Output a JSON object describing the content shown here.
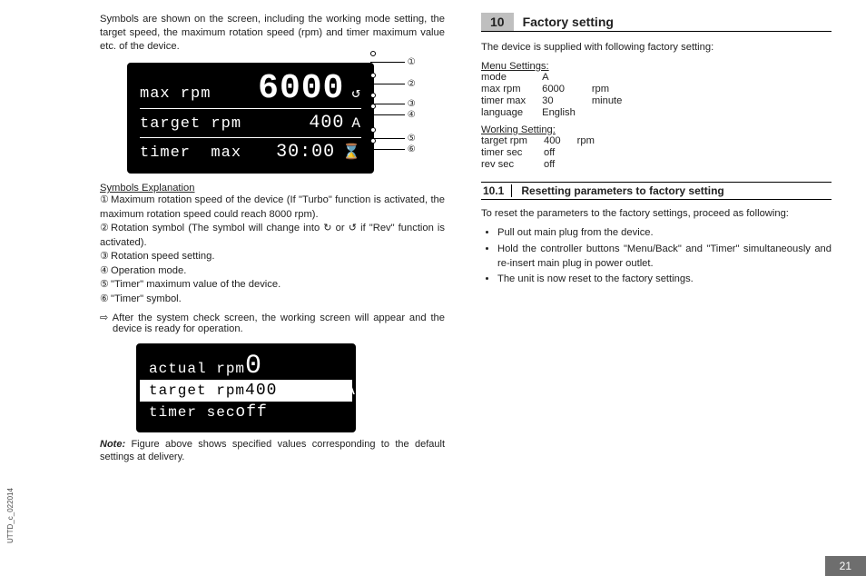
{
  "left": {
    "intro": "Symbols are shown on the screen, including the working mode setting, the target speed, the maximum rotation speed (rpm) and timer maximum value etc. of the device.",
    "lcd1": {
      "row1_label": "max rpm",
      "row1_value": "6000",
      "row1_icon": "↺",
      "row2_label": "target rpm",
      "row2_value": "400",
      "row2_right": "A",
      "row3_label": "timer  max",
      "row3_value": "30:00",
      "row3_icon": "⌛"
    },
    "callouts": {
      "c1": "①",
      "c2": "②",
      "c3": "③",
      "c4": "④",
      "c5": "⑤",
      "c6": "⑥"
    },
    "symexp_head": "Symbols Explanation",
    "symexp": {
      "s1n": "①",
      "s1": "Maximum rotation speed of the device (If \"Turbo\" function is activated, the maximum rotation speed could reach 8000 rpm).",
      "s2n": "②",
      "s2a": "Rotation symbol (The symbol will change into ",
      "s2b": " or ",
      "s2c": " if  \"Rev\" function is activated).",
      "s2i1": "↻",
      "s2i2": "↺",
      "s3n": "③",
      "s3": "Rotation speed setting.",
      "s4n": "④",
      "s4": "Operation mode.",
      "s5n": "⑤",
      "s5": "\"Timer\" maximum value of the device.",
      "s6n": "⑥",
      "s6": "\"Timer\" symbol."
    },
    "arrow_sym": "⇨",
    "arrow_text": "After the system check screen, the working screen will appear and the device is ready for operation.",
    "lcd2": {
      "row1_label": "actual rpm",
      "row1_value": "0",
      "row2_label": "target rpm",
      "row2_value": "400",
      "row2_right": "A",
      "row3_label": "timer sec",
      "row3_value": "off"
    },
    "note_b": "Note:",
    "note": " Figure above shows specified values corresponding to the default settings at delivery."
  },
  "right": {
    "sec_num": "10",
    "sec_title": "Factory setting",
    "intro": "The device is supplied with following factory setting:",
    "menu_head": "Menu Settings:",
    "menu": [
      [
        "mode",
        "A",
        ""
      ],
      [
        "max rpm",
        "6000",
        "rpm"
      ],
      [
        "timer max",
        "30",
        "minute"
      ],
      [
        "language",
        "English",
        ""
      ]
    ],
    "work_head": "Working Setting:",
    "work": [
      [
        "target rpm",
        "400",
        "rpm"
      ],
      [
        "timer sec",
        "off",
        ""
      ],
      [
        "rev sec",
        "off",
        ""
      ]
    ],
    "sub_num": "10.1",
    "sub_title": "Resetting parameters to factory setting",
    "sub_intro": "To reset the parameters to the factory settings, proceed as following:",
    "bullets": [
      "Pull out main plug from the device.",
      "Hold the controller buttons \"Menu/Back\" and \"Timer\" simultaneously and re-insert main plug in power outlet.",
      "The unit is now reset to the factory settings."
    ]
  },
  "footer": {
    "side": "UTTD_c_022014",
    "page": "21"
  }
}
